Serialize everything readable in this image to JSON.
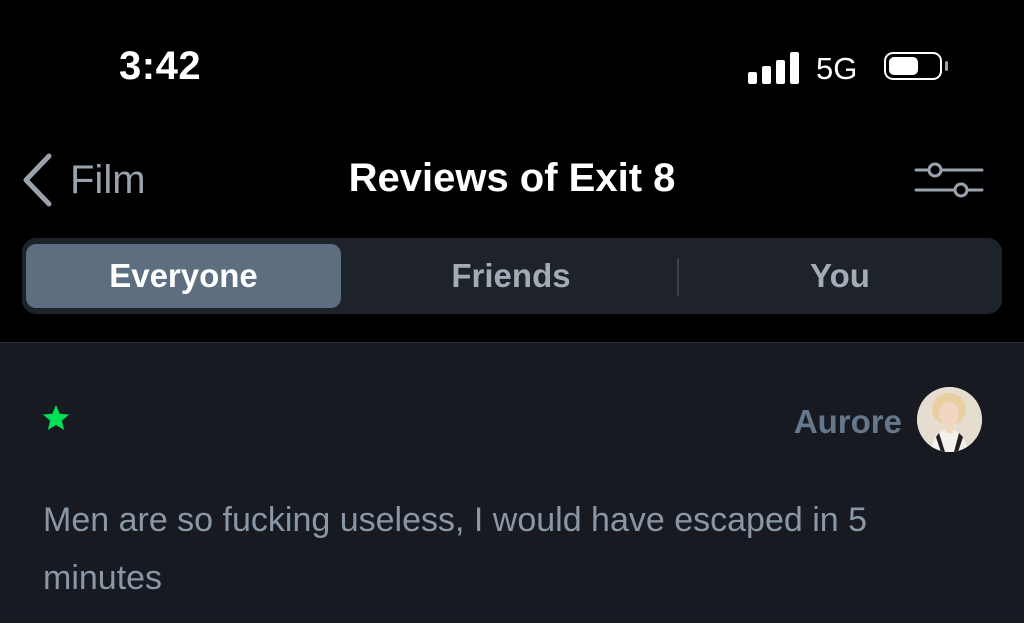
{
  "status_bar": {
    "time": "3:42",
    "network": "5G",
    "battery_level": 0.6
  },
  "nav": {
    "back_label": "Film",
    "title": "Reviews of Exit 8",
    "filter_icon": "sliders-icon"
  },
  "tabs": [
    {
      "label": "Everyone",
      "active": true
    },
    {
      "label": "Friends",
      "active": false
    },
    {
      "label": "You",
      "active": false
    }
  ],
  "review": {
    "author": "Aurore",
    "rating_stars": 1,
    "text": "Men are so fucking useless, I would have escaped in 5 minutes"
  },
  "colors": {
    "star": "#00e054",
    "active_tab": "#5d6e80",
    "author": "#65778a",
    "review_text": "#8a97a6",
    "content_bg": "#171b21"
  }
}
